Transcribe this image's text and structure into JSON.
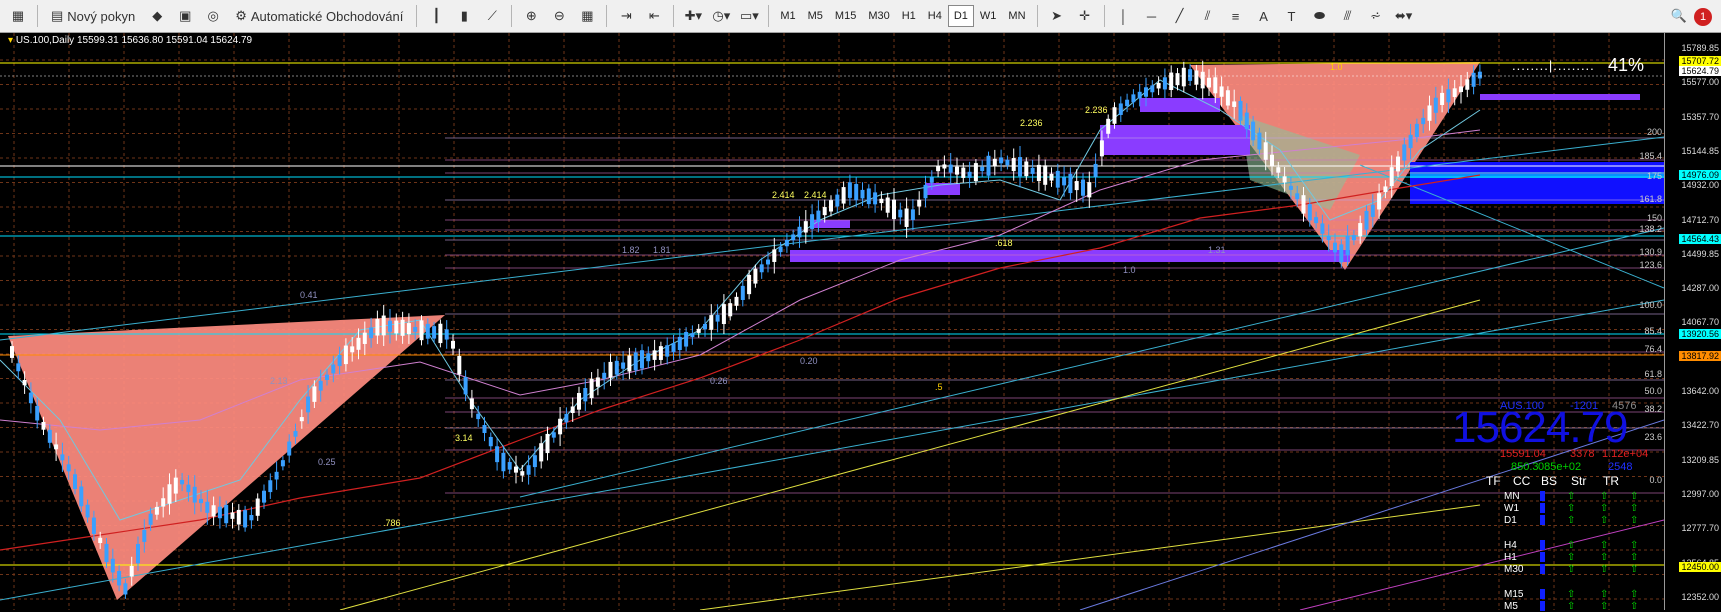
{
  "toolbar": {
    "new_order_label": "Nový pokyn",
    "autotrading_label": "Automatické Obchodování",
    "timeframes": [
      "M1",
      "M5",
      "M15",
      "M30",
      "H1",
      "H4",
      "D1",
      "W1",
      "MN"
    ],
    "active_timeframe": "D1",
    "notification_count": "1"
  },
  "chart": {
    "symbol_line": "US.100,Daily  15599.31 15636.80 15591.04 15624.79",
    "price_labels": [
      "15789.85",
      "15577.00",
      "15357.70",
      "15144.85",
      "14932.00",
      "14712.70",
      "14499.85",
      "14287.00",
      "14067.70",
      "13854.85",
      "13642.00",
      "13422.70",
      "13209.85",
      "12997.00",
      "12777.70",
      "12564.85",
      "12352.00"
    ],
    "price_boxes": [
      {
        "text": "15707.72",
        "bg": "#ffff00",
        "fg": "#000"
      },
      {
        "text": "15624.79",
        "bg": "#ffffff",
        "fg": "#000"
      },
      {
        "text": "14976.09",
        "bg": "#00ffff",
        "fg": "#000"
      },
      {
        "text": "14564.43",
        "bg": "#00ffff",
        "fg": "#000"
      },
      {
        "text": "13920.56",
        "bg": "#00ffff",
        "fg": "#000"
      },
      {
        "text": "13817.92",
        "bg": "#ff8c00",
        "fg": "#000"
      },
      {
        "text": "12450.00",
        "bg": "#ffff00",
        "fg": "#000"
      }
    ],
    "fib_levels": [
      "200",
      "185.4",
      "175",
      "161.8",
      "150",
      "138.2",
      "130.9",
      "123.6",
      "100.0",
      "85.4",
      "76.4",
      "61.8",
      "50.0",
      "38.2",
      "23.6",
      "0.0"
    ],
    "pattern_labels": [
      "2.414",
      "2.414",
      "2.236",
      "2.236",
      "1.82",
      "1.81",
      "1.0",
      "3.14",
      "0.25",
      ".786",
      ".618",
      "1.31",
      "0.20",
      "0.26",
      ".5",
      "1.0",
      "2.13",
      "0.41"
    ],
    "percent_label": "41%",
    "big_price": "15624.79",
    "stats_line1": [
      "-1201",
      "4576"
    ],
    "stats_line2": [
      "15591.04",
      "3378",
      "1.12e+04"
    ],
    "stats_line3": [
      "850.3",
      "085e+02",
      "2548"
    ],
    "panel_headers": [
      "TF",
      "CC",
      "BS",
      "Str",
      "TR"
    ],
    "panel_timeframes": [
      "MN",
      "W1",
      "D1",
      "H4",
      "H1",
      "M30",
      "M15",
      "M5"
    ]
  },
  "colors": {
    "background": "#000000",
    "grid": "#7a3a1a",
    "bull": "#ffffff",
    "bear": "#3aa0ff",
    "triangle": "#ff8c80",
    "purple": "#8a3cff",
    "blue_band": "#1010ff"
  }
}
